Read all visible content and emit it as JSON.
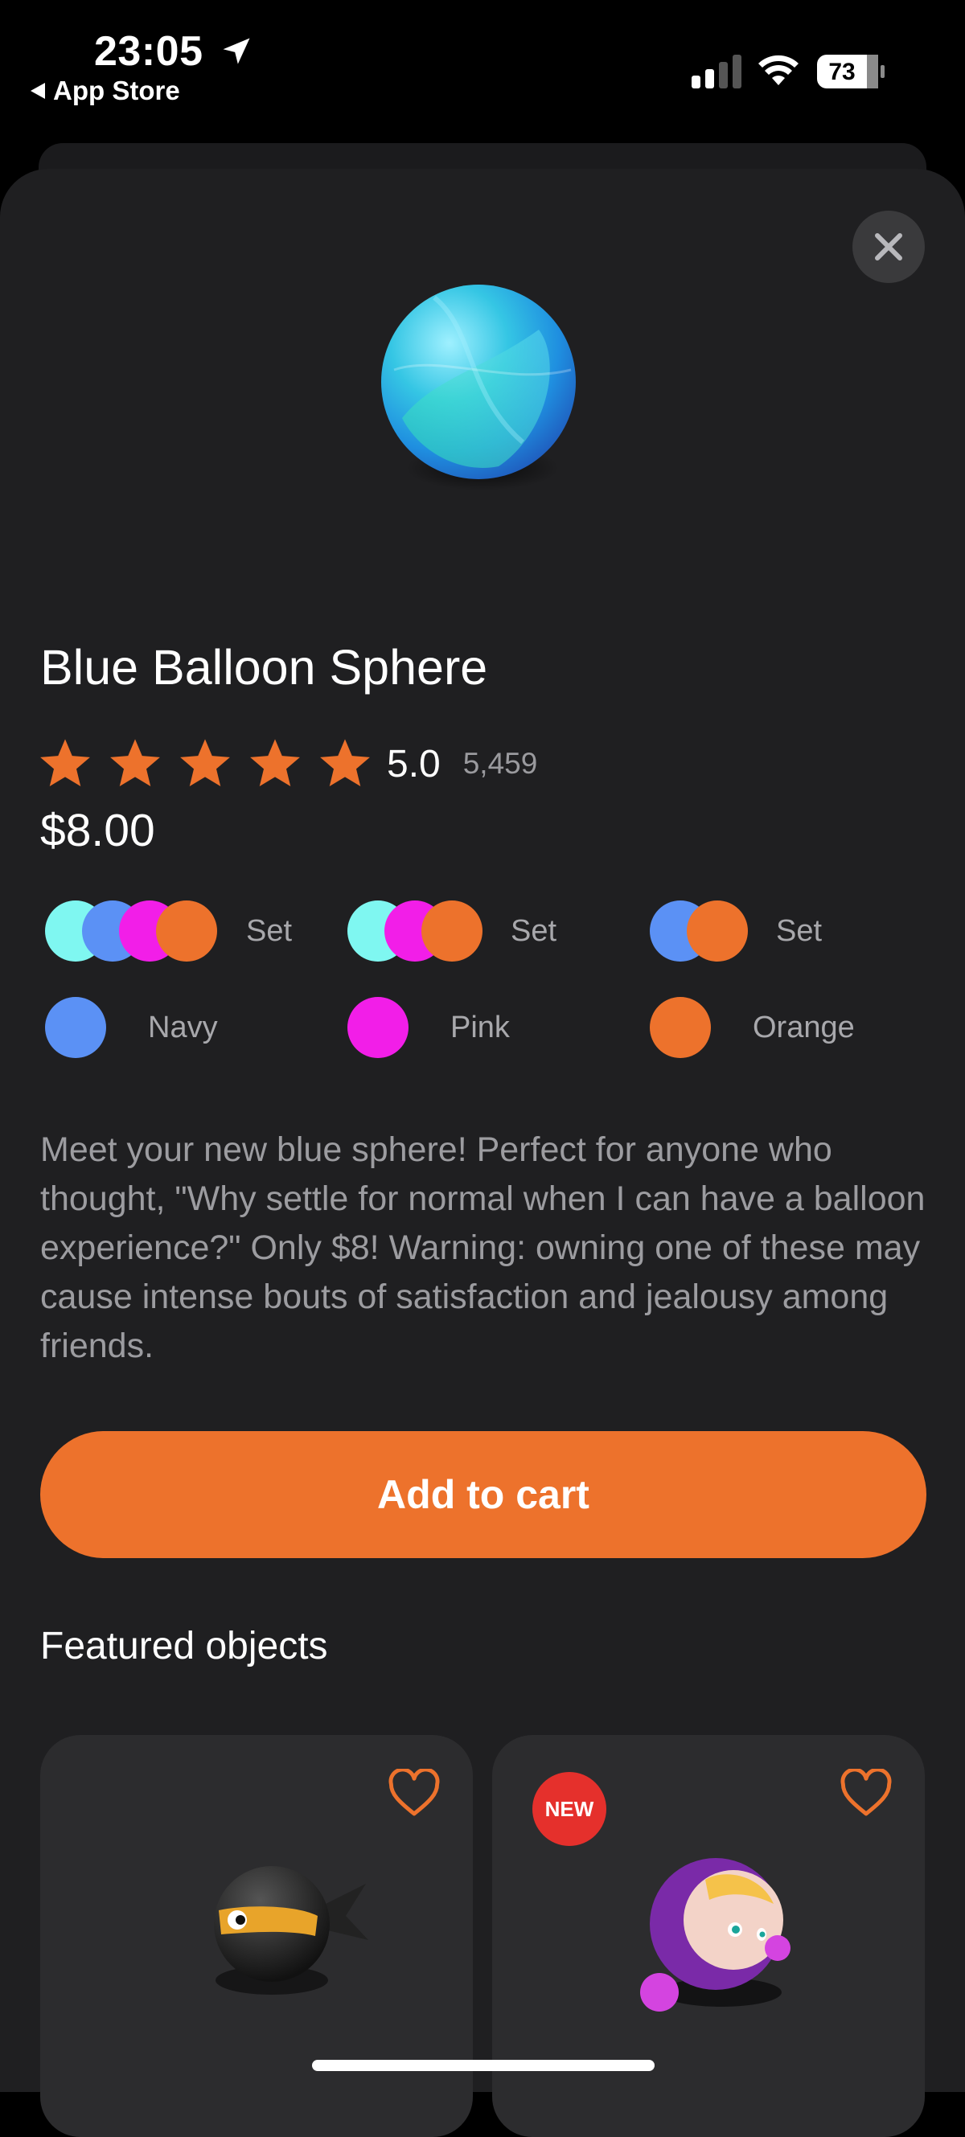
{
  "status_bar": {
    "time": "23:05",
    "back_label": "App Store",
    "battery": "73"
  },
  "product": {
    "name": "Blue Balloon Sphere",
    "rating": "5.0",
    "rating_count": "5,459",
    "stars": 5,
    "price": "$8.00",
    "description": "Meet your new blue sphere! Perfect for anyone who thought, \"Why settle for normal when I can have a balloon experience?\" Only $8! Warning: owning one of these may cause intense bouts of satisfaction and jealousy among friends."
  },
  "options": [
    {
      "label": "Set",
      "colors": [
        "#7ff7f1",
        "#5b91f5",
        "#f21ee8",
        "#ed722c"
      ]
    },
    {
      "label": "Set",
      "colors": [
        "#7ff7f1",
        "#f21ee8",
        "#ed722c"
      ]
    },
    {
      "label": "Set",
      "colors": [
        "#5b91f5",
        "#ed722c"
      ]
    },
    {
      "label": "Navy",
      "colors": [
        "#5b91f5"
      ]
    },
    {
      "label": "Pink",
      "colors": [
        "#f21ee8"
      ]
    },
    {
      "label": "Orange",
      "colors": [
        "#ed722c"
      ]
    }
  ],
  "actions": {
    "add_to_cart": "Add to cart"
  },
  "featured": {
    "heading": "Featured objects",
    "items": [
      {
        "icon": "ninja-object-icon",
        "badge": ""
      },
      {
        "icon": "astronaut-object-icon",
        "badge": "NEW"
      }
    ]
  },
  "colors": {
    "accent": "#ed722c",
    "sheet": "#1f1f21",
    "card": "#2c2c2e",
    "badge": "#e5302c"
  }
}
